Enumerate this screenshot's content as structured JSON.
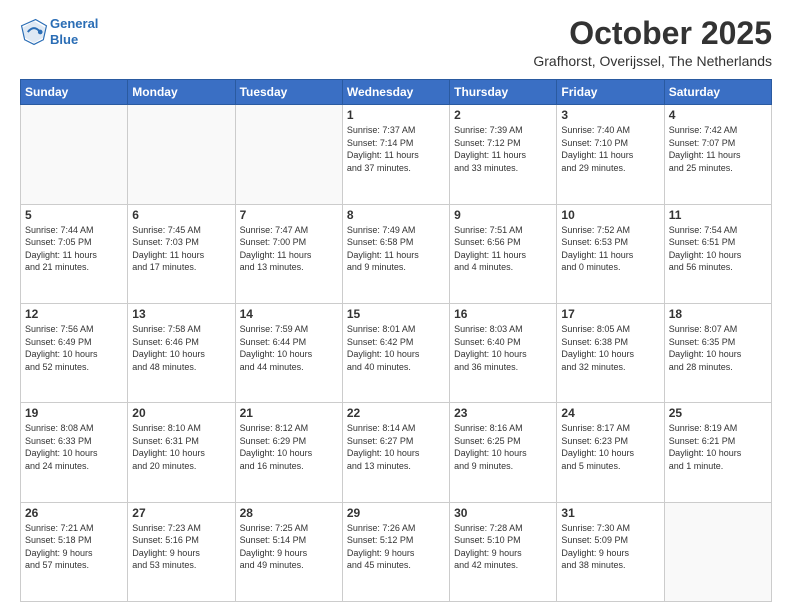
{
  "header": {
    "logo_line1": "General",
    "logo_line2": "Blue",
    "month_title": "October 2025",
    "location": "Grafhorst, Overijssel, The Netherlands"
  },
  "days_of_week": [
    "Sunday",
    "Monday",
    "Tuesday",
    "Wednesday",
    "Thursday",
    "Friday",
    "Saturday"
  ],
  "weeks": [
    [
      {
        "day": "",
        "info": ""
      },
      {
        "day": "",
        "info": ""
      },
      {
        "day": "",
        "info": ""
      },
      {
        "day": "1",
        "info": "Sunrise: 7:37 AM\nSunset: 7:14 PM\nDaylight: 11 hours\nand 37 minutes."
      },
      {
        "day": "2",
        "info": "Sunrise: 7:39 AM\nSunset: 7:12 PM\nDaylight: 11 hours\nand 33 minutes."
      },
      {
        "day": "3",
        "info": "Sunrise: 7:40 AM\nSunset: 7:10 PM\nDaylight: 11 hours\nand 29 minutes."
      },
      {
        "day": "4",
        "info": "Sunrise: 7:42 AM\nSunset: 7:07 PM\nDaylight: 11 hours\nand 25 minutes."
      }
    ],
    [
      {
        "day": "5",
        "info": "Sunrise: 7:44 AM\nSunset: 7:05 PM\nDaylight: 11 hours\nand 21 minutes."
      },
      {
        "day": "6",
        "info": "Sunrise: 7:45 AM\nSunset: 7:03 PM\nDaylight: 11 hours\nand 17 minutes."
      },
      {
        "day": "7",
        "info": "Sunrise: 7:47 AM\nSunset: 7:00 PM\nDaylight: 11 hours\nand 13 minutes."
      },
      {
        "day": "8",
        "info": "Sunrise: 7:49 AM\nSunset: 6:58 PM\nDaylight: 11 hours\nand 9 minutes."
      },
      {
        "day": "9",
        "info": "Sunrise: 7:51 AM\nSunset: 6:56 PM\nDaylight: 11 hours\nand 4 minutes."
      },
      {
        "day": "10",
        "info": "Sunrise: 7:52 AM\nSunset: 6:53 PM\nDaylight: 11 hours\nand 0 minutes."
      },
      {
        "day": "11",
        "info": "Sunrise: 7:54 AM\nSunset: 6:51 PM\nDaylight: 10 hours\nand 56 minutes."
      }
    ],
    [
      {
        "day": "12",
        "info": "Sunrise: 7:56 AM\nSunset: 6:49 PM\nDaylight: 10 hours\nand 52 minutes."
      },
      {
        "day": "13",
        "info": "Sunrise: 7:58 AM\nSunset: 6:46 PM\nDaylight: 10 hours\nand 48 minutes."
      },
      {
        "day": "14",
        "info": "Sunrise: 7:59 AM\nSunset: 6:44 PM\nDaylight: 10 hours\nand 44 minutes."
      },
      {
        "day": "15",
        "info": "Sunrise: 8:01 AM\nSunset: 6:42 PM\nDaylight: 10 hours\nand 40 minutes."
      },
      {
        "day": "16",
        "info": "Sunrise: 8:03 AM\nSunset: 6:40 PM\nDaylight: 10 hours\nand 36 minutes."
      },
      {
        "day": "17",
        "info": "Sunrise: 8:05 AM\nSunset: 6:38 PM\nDaylight: 10 hours\nand 32 minutes."
      },
      {
        "day": "18",
        "info": "Sunrise: 8:07 AM\nSunset: 6:35 PM\nDaylight: 10 hours\nand 28 minutes."
      }
    ],
    [
      {
        "day": "19",
        "info": "Sunrise: 8:08 AM\nSunset: 6:33 PM\nDaylight: 10 hours\nand 24 minutes."
      },
      {
        "day": "20",
        "info": "Sunrise: 8:10 AM\nSunset: 6:31 PM\nDaylight: 10 hours\nand 20 minutes."
      },
      {
        "day": "21",
        "info": "Sunrise: 8:12 AM\nSunset: 6:29 PM\nDaylight: 10 hours\nand 16 minutes."
      },
      {
        "day": "22",
        "info": "Sunrise: 8:14 AM\nSunset: 6:27 PM\nDaylight: 10 hours\nand 13 minutes."
      },
      {
        "day": "23",
        "info": "Sunrise: 8:16 AM\nSunset: 6:25 PM\nDaylight: 10 hours\nand 9 minutes."
      },
      {
        "day": "24",
        "info": "Sunrise: 8:17 AM\nSunset: 6:23 PM\nDaylight: 10 hours\nand 5 minutes."
      },
      {
        "day": "25",
        "info": "Sunrise: 8:19 AM\nSunset: 6:21 PM\nDaylight: 10 hours\nand 1 minute."
      }
    ],
    [
      {
        "day": "26",
        "info": "Sunrise: 7:21 AM\nSunset: 5:18 PM\nDaylight: 9 hours\nand 57 minutes."
      },
      {
        "day": "27",
        "info": "Sunrise: 7:23 AM\nSunset: 5:16 PM\nDaylight: 9 hours\nand 53 minutes."
      },
      {
        "day": "28",
        "info": "Sunrise: 7:25 AM\nSunset: 5:14 PM\nDaylight: 9 hours\nand 49 minutes."
      },
      {
        "day": "29",
        "info": "Sunrise: 7:26 AM\nSunset: 5:12 PM\nDaylight: 9 hours\nand 45 minutes."
      },
      {
        "day": "30",
        "info": "Sunrise: 7:28 AM\nSunset: 5:10 PM\nDaylight: 9 hours\nand 42 minutes."
      },
      {
        "day": "31",
        "info": "Sunrise: 7:30 AM\nSunset: 5:09 PM\nDaylight: 9 hours\nand 38 minutes."
      },
      {
        "day": "",
        "info": ""
      }
    ]
  ]
}
